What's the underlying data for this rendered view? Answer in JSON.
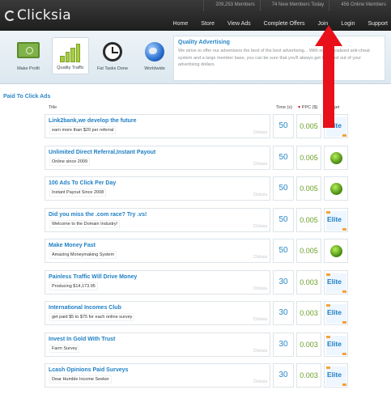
{
  "header": {
    "brand": "Clicksia",
    "stats": [
      "209,253 Members",
      "74 New Members Today",
      "456 Online Members"
    ],
    "nav": [
      "Home",
      "Store",
      "View Ads",
      "Complete Offers",
      "Join",
      "Login",
      "Support"
    ]
  },
  "features": {
    "tiles": [
      {
        "label": "Make Profit",
        "icon": "money-icon"
      },
      {
        "label": "Quality Traffic",
        "icon": "bar-chart-icon"
      },
      {
        "label": "Fat Tasks Done",
        "icon": "clock-icon"
      },
      {
        "label": "Worldwide",
        "icon": "globe-icon"
      }
    ],
    "active_index": 1,
    "info_title": "Quality Advertising",
    "info_body": "We strive to offer our advertisers the best of the best advertising... With our specialized anti-cheat system and a large member base, you can be sure that you'll always get the most out of your advertising dollars."
  },
  "section": {
    "title": "Paid To Click Ads",
    "columns": {
      "title": "Title",
      "time": "Time (s)",
      "ppc": "PPC ($)",
      "target": "Target"
    }
  },
  "ads": [
    {
      "title": "Link2bank,we develop the future",
      "desc": "earn more than $20 per referral",
      "source": "Clicksia",
      "time": "50",
      "ppc": "0.005",
      "target": "Elite"
    },
    {
      "title": "Unlimited Direct Referral,Instant Payout",
      "desc": "Online since 2009",
      "source": "Clicksia",
      "time": "50",
      "ppc": "0.005",
      "target": "Worldwide"
    },
    {
      "title": "100 Ads To Click Per Day",
      "desc": "Instant Payout Since 2008",
      "source": "Clicksia",
      "time": "50",
      "ppc": "0.005",
      "target": "Worldwide"
    },
    {
      "title": "Did you miss the .com race? Try .vs!",
      "desc": "Welcome to the Domain Industry!",
      "source": "Clicksia",
      "time": "50",
      "ppc": "0.005",
      "target": "Elite"
    },
    {
      "title": "Make Money Fast",
      "desc": "Amazing Moneymaking System",
      "source": "Clicksia",
      "time": "50",
      "ppc": "0.005",
      "target": "Worldwide"
    },
    {
      "title": "Painless Traffic Will Drive Money",
      "desc": "Producing $14,173.95",
      "source": "Clicksia",
      "time": "30",
      "ppc": "0.003",
      "target": "Elite"
    },
    {
      "title": "International Incomes Club",
      "desc": "get paid $5 to $75 for each online survey",
      "source": "Clicksia",
      "time": "30",
      "ppc": "0.003",
      "target": "Elite"
    },
    {
      "title": "Invest In Gold With Trust",
      "desc": "Farm Survey",
      "source": "Clicksia",
      "time": "30",
      "ppc": "0.003",
      "target": "Elite"
    },
    {
      "title": "Lcash Opinions Paid Surveys",
      "desc": "Dear Humble Income Seeker",
      "source": "Clicksia",
      "time": "30",
      "ppc": "0.003",
      "target": "Elite"
    }
  ],
  "colors": {
    "accent": "#2a88c8",
    "ppc_green": "#6aa126",
    "header_bg": "#2a2a2a",
    "arrow_red": "#e8101a"
  }
}
